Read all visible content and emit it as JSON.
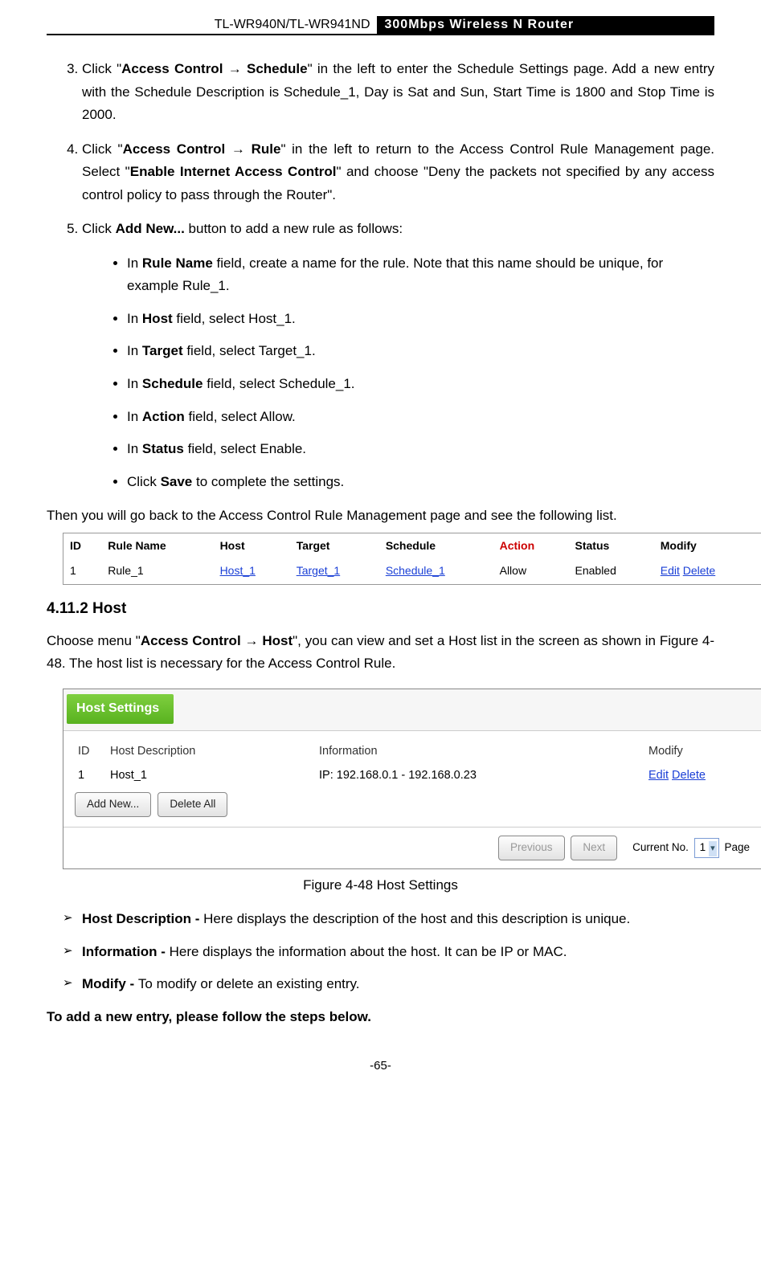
{
  "header": {
    "model": "TL-WR940N/TL-WR941ND",
    "title": "300Mbps Wireless N Router"
  },
  "steps": {
    "s3_click": "Click \"",
    "s3_path": "Access Control → Schedule",
    "s3_rest": "\" in the left to enter the Schedule Settings page. Add a new entry with the Schedule Description is Schedule_1, Day is Sat and Sun, Start Time is 1800 and Stop Time is 2000.",
    "s4_click": "Click \"",
    "s4_path": "Access Control → Rule",
    "s4_mid1": "\" in the left to return to the Access Control Rule Management page. Select \"",
    "s4_bold": "Enable Internet Access Control",
    "s4_rest": "\" and choose \"Deny the packets not specified by any access control policy to pass through the Router\".",
    "s5_click": "Click ",
    "s5_bold": "Add New...",
    "s5_rest": " button to add a new rule as follows:"
  },
  "sub": {
    "b1a": "In ",
    "b1b": "Rule Name",
    "b1c": " field, create a name for the rule. Note that this name should be unique, for example Rule_1.",
    "b2a": "In ",
    "b2b": "Host",
    "b2c": " field, select Host_1.",
    "b3a": "In ",
    "b3b": "Target",
    "b3c": " field, select Target_1.",
    "b4a": "In ",
    "b4b": "Schedule",
    "b4c": " field, select Schedule_1.",
    "b5a": "In ",
    "b5b": "Action",
    "b5c": " field, select Allow.",
    "b6a": "In ",
    "b6b": "Status",
    "b6c": " field, select Enable.",
    "b7a": "Click ",
    "b7b": "Save",
    "b7c": " to complete the settings."
  },
  "back_text": "Then you will go back to the Access Control Rule Management page and see the following list.",
  "rule_table": {
    "headers": {
      "id": "ID",
      "rule": "Rule Name",
      "host": "Host",
      "target": "Target",
      "schedule": "Schedule",
      "action": "Action",
      "status": "Status",
      "modify": "Modify"
    },
    "row": {
      "id": "1",
      "rule": "Rule_1",
      "host": "Host_1",
      "target": "Target_1",
      "schedule": "Schedule_1",
      "action": "Allow",
      "status": "Enabled",
      "edit": "Edit",
      "delete": "Delete"
    }
  },
  "section_heading": "4.11.2 Host",
  "host_para": {
    "a": "Choose menu \"",
    "b": "Access Control → Host",
    "c": "\", you can view and set a Host list in the screen as shown in Figure 4-48. The host list is necessary for the Access Control Rule."
  },
  "host_settings": {
    "title": "Host Settings",
    "headers": {
      "id": "ID",
      "desc": "Host Description",
      "info": "Information",
      "modify": "Modify"
    },
    "row": {
      "id": "1",
      "desc": "Host_1",
      "info": "IP: 192.168.0.1 - 192.168.0.23",
      "edit": "Edit",
      "delete": "Delete"
    },
    "buttons": {
      "add": "Add New...",
      "del": "Delete All",
      "prev": "Previous",
      "next": "Next"
    },
    "footer": {
      "current": "Current No.",
      "value": "1",
      "page": "Page"
    }
  },
  "caption": "Figure 4-48    Host Settings",
  "triangles": {
    "t1b": "Host Description - ",
    "t1t": "Here displays the description of the host and this description is unique.",
    "t2b": "Information - ",
    "t2t": "Here displays the information about the host. It can be IP or MAC.",
    "t3b": "Modify - ",
    "t3t": "To modify or delete an existing entry."
  },
  "new_entry": "To add a new entry, please follow the steps below.",
  "pagenum": "-65-"
}
